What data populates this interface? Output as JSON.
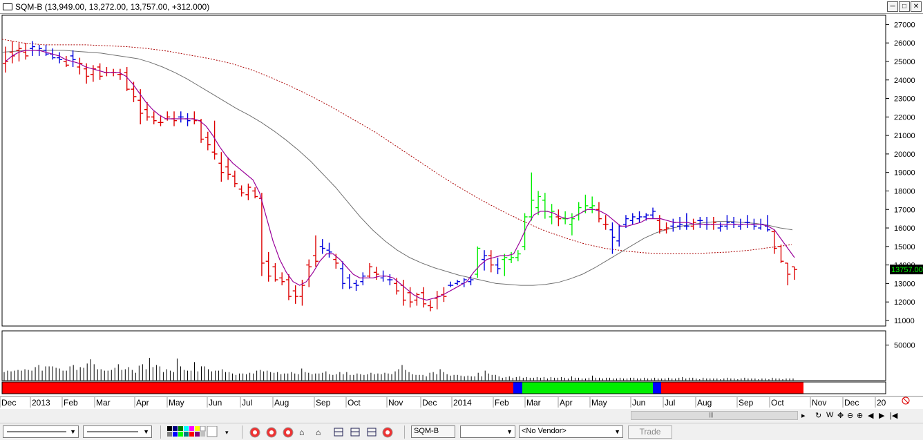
{
  "window": {
    "title": "SQM-B (13,949.00, 13,272.00, 13,757.00, +312.000)",
    "minimize": "─",
    "maximize": "□",
    "close": "✕"
  },
  "chart_data": {
    "type": "ohlc",
    "symbol": "SQM-B",
    "ylim": [
      10700,
      27500
    ],
    "price_ticks": [
      "27000",
      "26000",
      "25000",
      "24000",
      "23000",
      "22000",
      "21000",
      "20000",
      "19000",
      "18000",
      "17000",
      "16000",
      "15000",
      "14000",
      "13000",
      "12000",
      "11000"
    ],
    "last_price": "13757.00",
    "volume_ticks": [
      "50000"
    ],
    "volume_ylim": [
      0,
      70000
    ],
    "x_labels": [
      "Dec",
      "2013",
      "Feb",
      "Mar",
      "Apr",
      "May",
      "Jun",
      "Jul",
      "Aug",
      "Sep",
      "Oct",
      "Nov",
      "Dec",
      "2014",
      "Feb",
      "Mar",
      "Apr",
      "May",
      "Jun",
      "Jul",
      "Aug",
      "Sep",
      "Oct",
      "Nov",
      "Dec",
      "20"
    ],
    "colors": {
      "up": "#00ee00",
      "down": "#dd0000",
      "neutral": "#0000dd",
      "ma_fast": "#990099",
      "ma_mid": "#707070",
      "ma_slow": "#aa0000",
      "ribbon_red": "#ff0000",
      "ribbon_green": "#00ee00",
      "ribbon_blue": "#0000ff"
    },
    "bars": [
      [
        24900,
        25800,
        24400,
        25000,
        "d"
      ],
      [
        25500,
        26100,
        24900,
        25300,
        "d"
      ],
      [
        25600,
        26000,
        25000,
        25700,
        "d"
      ],
      [
        25500,
        26000,
        25100,
        25300,
        "d"
      ],
      [
        25700,
        26100,
        25300,
        25800,
        "n"
      ],
      [
        25600,
        25900,
        25300,
        25700,
        "n"
      ],
      [
        25600,
        25900,
        25300,
        25400,
        "n"
      ],
      [
        25400,
        25700,
        25100,
        25200,
        "n"
      ],
      [
        25200,
        25500,
        24900,
        25100,
        "n"
      ],
      [
        25000,
        25300,
        24700,
        24800,
        "d"
      ],
      [
        25300,
        25600,
        24700,
        25100,
        "n"
      ],
      [
        24700,
        25200,
        24300,
        24900,
        "d"
      ],
      [
        24600,
        24900,
        23800,
        24200,
        "d"
      ],
      [
        24300,
        24800,
        23900,
        24600,
        "d"
      ],
      [
        24700,
        24900,
        24000,
        24200,
        "d"
      ],
      [
        24400,
        24700,
        24200,
        24400,
        "d"
      ],
      [
        24400,
        24600,
        24200,
        24400,
        "d"
      ],
      [
        24300,
        24600,
        24000,
        24300,
        "d"
      ],
      [
        24400,
        24700,
        23400,
        23500,
        "d"
      ],
      [
        23500,
        23900,
        22800,
        23100,
        "d"
      ],
      [
        22900,
        23500,
        21600,
        22200,
        "d"
      ],
      [
        22400,
        22800,
        21800,
        22000,
        "d"
      ],
      [
        22000,
        22300,
        21600,
        21800,
        "d"
      ],
      [
        21700,
        22100,
        21500,
        21700,
        "d"
      ],
      [
        21900,
        22300,
        21800,
        22000,
        "d"
      ],
      [
        21900,
        22300,
        21500,
        21800,
        "d"
      ],
      [
        22000,
        22300,
        21700,
        22000,
        "n"
      ],
      [
        21900,
        22200,
        21500,
        21800,
        "n"
      ],
      [
        21900,
        22300,
        21600,
        21800,
        "d"
      ],
      [
        21800,
        21900,
        20600,
        20800,
        "d"
      ],
      [
        20900,
        21200,
        20200,
        20500,
        "d"
      ],
      [
        20100,
        21800,
        19700,
        20000,
        "d"
      ],
      [
        19500,
        20100,
        18500,
        19000,
        "d"
      ],
      [
        19300,
        19800,
        18600,
        18900,
        "d"
      ],
      [
        18800,
        19100,
        18200,
        18400,
        "d"
      ],
      [
        18100,
        18300,
        17700,
        17900,
        "d"
      ],
      [
        17800,
        18400,
        17500,
        18200,
        "d"
      ],
      [
        18000,
        18200,
        17600,
        17700,
        "d"
      ],
      [
        17600,
        17900,
        13400,
        14100,
        "d"
      ],
      [
        14200,
        14700,
        13100,
        13400,
        "d"
      ],
      [
        13900,
        14100,
        13100,
        13200,
        "d"
      ],
      [
        13300,
        13600,
        12900,
        13100,
        "d"
      ],
      [
        13200,
        13500,
        12100,
        12300,
        "d"
      ],
      [
        12600,
        12900,
        11900,
        12300,
        "d"
      ],
      [
        12300,
        13200,
        11800,
        12900,
        "d"
      ],
      [
        14000,
        14300,
        12800,
        13900,
        "d"
      ],
      [
        14500,
        15600,
        13900,
        14200,
        "d"
      ],
      [
        15000,
        15400,
        14600,
        14900,
        "n"
      ],
      [
        14800,
        15200,
        14400,
        14700,
        "n"
      ],
      [
        14300,
        14600,
        13800,
        14100,
        "d"
      ],
      [
        13800,
        14200,
        12700,
        13000,
        "n"
      ],
      [
        13300,
        13500,
        12700,
        12800,
        "n"
      ],
      [
        13000,
        13200,
        12600,
        12900,
        "n"
      ],
      [
        13100,
        13600,
        12900,
        13400,
        "n"
      ],
      [
        13400,
        14100,
        13300,
        13900,
        "d"
      ],
      [
        13600,
        13900,
        13200,
        13500,
        "d"
      ],
      [
        13300,
        13700,
        13100,
        13400,
        "n"
      ],
      [
        13200,
        13500,
        12900,
        13200,
        "n"
      ],
      [
        13000,
        13300,
        12400,
        12600,
        "d"
      ],
      [
        12900,
        13200,
        11800,
        12100,
        "d"
      ],
      [
        12500,
        12800,
        11700,
        12000,
        "d"
      ],
      [
        12100,
        12500,
        11800,
        12400,
        "d"
      ],
      [
        12500,
        12800,
        11700,
        11900,
        "d"
      ],
      [
        11800,
        12100,
        11500,
        11700,
        "d"
      ],
      [
        12200,
        12600,
        11600,
        12300,
        "d"
      ],
      [
        12400,
        12800,
        12000,
        12300,
        "d"
      ],
      [
        12900,
        13100,
        12800,
        12900,
        "n"
      ],
      [
        13000,
        13200,
        12900,
        13100,
        "n"
      ],
      [
        13000,
        13300,
        12800,
        13200,
        "n"
      ],
      [
        13100,
        13400,
        12900,
        13200,
        "n"
      ],
      [
        13500,
        15000,
        13300,
        14900,
        "u"
      ],
      [
        14300,
        14800,
        13700,
        14500,
        "n"
      ],
      [
        14500,
        14800,
        13600,
        14000,
        "d"
      ],
      [
        14000,
        14400,
        13500,
        13800,
        "n"
      ],
      [
        14300,
        14600,
        13400,
        14400,
        "u"
      ],
      [
        14300,
        14700,
        14100,
        14400,
        "u"
      ],
      [
        14400,
        14800,
        14200,
        14600,
        "u"
      ],
      [
        15000,
        16800,
        14800,
        16600,
        "u"
      ],
      [
        16600,
        19000,
        16400,
        17500,
        "u"
      ],
      [
        17100,
        18000,
        16700,
        17700,
        "u"
      ],
      [
        17500,
        17900,
        16500,
        16900,
        "u"
      ],
      [
        16600,
        17300,
        16200,
        16900,
        "u"
      ],
      [
        16600,
        17000,
        16100,
        16500,
        "d"
      ],
      [
        16500,
        16900,
        16200,
        16500,
        "u"
      ],
      [
        16200,
        16800,
        15600,
        16500,
        "u"
      ],
      [
        16700,
        17400,
        16400,
        17100,
        "u"
      ],
      [
        16900,
        17800,
        16800,
        17200,
        "u"
      ],
      [
        17100,
        17700,
        16800,
        17200,
        "u"
      ],
      [
        17000,
        17400,
        16300,
        16500,
        "d"
      ],
      [
        16200,
        16700,
        15900,
        16200,
        "d"
      ],
      [
        15900,
        16300,
        14600,
        15500,
        "n"
      ],
      [
        15300,
        16200,
        15000,
        16100,
        "n"
      ],
      [
        16200,
        16700,
        16000,
        16500,
        "n"
      ],
      [
        16400,
        16800,
        16200,
        16600,
        "n"
      ],
      [
        16500,
        16900,
        16300,
        16600,
        "n"
      ],
      [
        16600,
        16800,
        16400,
        16700,
        "n"
      ],
      [
        16700,
        17100,
        16500,
        16900,
        "n"
      ],
      [
        16400,
        16700,
        15700,
        15900,
        "d"
      ],
      [
        15900,
        16300,
        15700,
        16000,
        "d"
      ],
      [
        16100,
        16500,
        15800,
        16300,
        "n"
      ],
      [
        16100,
        16600,
        15900,
        16200,
        "n"
      ],
      [
        16100,
        16800,
        15900,
        16100,
        "n"
      ],
      [
        16100,
        16500,
        15900,
        16300,
        "d"
      ],
      [
        16400,
        16600,
        16000,
        16400,
        "n"
      ],
      [
        16200,
        16600,
        15900,
        16200,
        "n"
      ],
      [
        16200,
        16600,
        15900,
        16300,
        "d"
      ],
      [
        16000,
        16300,
        15800,
        16100,
        "n"
      ],
      [
        16100,
        16700,
        15900,
        16300,
        "n"
      ],
      [
        16300,
        16600,
        16000,
        16200,
        "n"
      ],
      [
        16100,
        16500,
        15900,
        16200,
        "n"
      ],
      [
        16300,
        16700,
        16000,
        16300,
        "n"
      ],
      [
        16200,
        16500,
        15900,
        16100,
        "n"
      ],
      [
        16000,
        16500,
        15900,
        16200,
        "n"
      ],
      [
        16100,
        16700,
        15800,
        15900,
        "n"
      ],
      [
        15800,
        15900,
        14600,
        14900,
        "d"
      ],
      [
        15000,
        15100,
        14100,
        14200,
        "d"
      ],
      [
        14100,
        14100,
        12900,
        13500,
        "d"
      ],
      [
        13900,
        13900,
        13200,
        13757,
        "d"
      ]
    ],
    "ma_fast": [
      25000,
      25300,
      25500,
      25600,
      25600,
      25600,
      25500,
      25400,
      25300,
      25100,
      25000,
      24900,
      24700,
      24600,
      24500,
      24400,
      24400,
      24400,
      24200,
      23800,
      23300,
      22800,
      22400,
      22100,
      21900,
      21900,
      21900,
      21900,
      21900,
      21800,
      21500,
      21000,
      20400,
      19900,
      19500,
      19200,
      18900,
      18600,
      17900,
      16600,
      15300,
      14300,
      13600,
      13100,
      12900,
      13100,
      13600,
      14200,
      14600,
      14600,
      14300,
      13900,
      13500,
      13300,
      13300,
      13300,
      13400,
      13400,
      13300,
      13000,
      12700,
      12400,
      12200,
      12100,
      12200,
      12300,
      12500,
      12700,
      12900,
      13100,
      13600,
      14000,
      14300,
      14400,
      14500,
      14500,
      14600,
      15300,
      16100,
      16700,
      16900,
      16900,
      16800,
      16600,
      16500,
      16600,
      16800,
      17000,
      17000,
      16900,
      16700,
      16400,
      16100,
      16100,
      16200,
      16300,
      16500,
      16500,
      16500,
      16400,
      16300,
      16300,
      16300,
      16200,
      16200,
      16200,
      16200,
      16200,
      16200,
      16200,
      16200,
      16200,
      16200,
      16200,
      16100,
      15900,
      15400,
      14900,
      14400
    ],
    "ma_mid": [
      25500,
      25550,
      25600,
      25600,
      25600,
      25600,
      25550,
      25500,
      25450,
      25350,
      25250,
      25150,
      24950,
      24700,
      24400,
      24050,
      23650,
      23250,
      22850,
      22450,
      22100,
      21700,
      21250,
      20750,
      20200,
      19600,
      18900,
      18200,
      17400,
      16600,
      15900,
      15300,
      14800,
      14400,
      14100,
      13850,
      13650,
      13450,
      13300,
      13150,
      13000,
      12950,
      12900,
      12900,
      12950,
      13050,
      13250,
      13500,
      13850,
      14250,
      14650,
      15050,
      15450,
      15750,
      15950,
      16100,
      16200,
      16300,
      16350,
      16350,
      16300,
      16250,
      16150,
      16000,
      15900
    ],
    "ma_slow": [
      26200,
      26000,
      25900,
      25900,
      25900,
      25850,
      25800,
      25700,
      25550,
      25350,
      25150,
      24900,
      24550,
      24100,
      23600,
      23050,
      22450,
      21800,
      21150,
      20400,
      19650,
      18900,
      18200,
      17550,
      16950,
      16400,
      15900,
      15500,
      15150,
      14900,
      14750,
      14650,
      14600,
      14600,
      14650,
      14700,
      14800,
      14950,
      15100
    ],
    "volume": [
      12,
      14,
      13,
      14,
      15,
      14,
      16,
      15,
      14,
      19,
      22,
      14,
      20,
      20,
      20,
      18,
      17,
      14,
      14,
      20,
      22,
      15,
      19,
      18,
      24,
      30,
      23,
      16,
      16,
      14,
      14,
      15,
      18,
      23,
      15,
      16,
      19,
      15,
      11,
      21,
      23,
      16,
      32,
      19,
      22,
      20,
      12,
      16,
      14,
      12,
      31,
      20,
      15,
      14,
      14,
      26,
      13,
      20,
      20,
      16,
      13,
      14,
      14,
      16,
      12,
      12,
      10,
      8,
      10,
      10,
      9,
      11,
      10,
      14,
      15,
      13,
      14,
      12,
      11,
      12,
      9,
      10,
      10,
      12,
      10,
      9,
      17,
      12,
      11,
      9,
      10,
      10,
      11,
      13,
      9,
      8,
      9,
      12,
      9,
      12,
      8,
      8,
      10,
      9,
      8,
      9,
      11,
      9,
      10,
      9,
      11,
      10,
      9,
      13,
      16,
      22,
      15,
      12,
      9,
      8,
      8,
      8,
      6,
      11,
      12,
      9,
      16,
      12,
      9,
      7,
      8,
      8,
      7,
      6,
      7,
      6,
      6,
      11,
      6,
      14,
      10,
      8,
      8,
      6,
      4,
      5,
      6,
      4,
      5,
      6,
      4,
      5,
      4,
      4,
      5,
      4,
      5,
      3,
      5,
      4,
      4,
      5,
      4,
      3,
      6,
      4,
      4,
      3,
      3,
      4,
      7,
      4,
      4,
      3,
      4,
      4,
      3,
      3,
      4,
      3,
      3,
      4,
      4,
      3,
      3,
      4,
      3,
      3,
      4,
      3,
      3,
      3,
      4,
      3,
      3,
      4,
      5,
      3,
      4,
      4,
      3,
      2,
      4,
      3,
      3,
      3,
      3,
      2,
      3,
      4,
      3,
      3,
      2,
      3,
      4,
      3,
      3,
      3,
      2,
      3,
      3,
      2,
      4,
      3,
      3,
      2,
      3,
      3,
      3
    ],
    "ribbon": [
      {
        "color": "red",
        "from": 0,
        "to": 740
      },
      {
        "color": "blue",
        "from": 740,
        "to": 753
      },
      {
        "color": "green",
        "from": 753,
        "to": 942
      },
      {
        "color": "blue",
        "from": 942,
        "to": 954
      },
      {
        "color": "red",
        "from": 954,
        "to": 1160
      }
    ]
  },
  "toolbar": {
    "symbol": "SQM-B",
    "vendor": "<No Vendor>",
    "trade": "Trade",
    "nav_glyphs": [
      "↻",
      "W",
      "✥",
      "⊖",
      "⊕",
      "◀",
      "▶",
      "|◀"
    ]
  }
}
